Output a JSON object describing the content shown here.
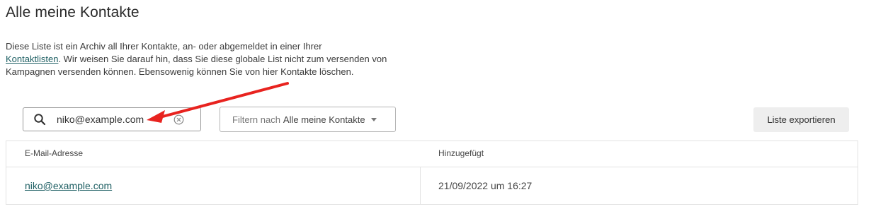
{
  "header": {
    "title": "Alle meine Kontakte"
  },
  "description": {
    "line1": "Diese Liste ist ein Archiv all Ihrer Kontakte, an- oder abgemeldet in einer Ihrer",
    "link": "Kontaktlisten",
    "rest": ". Wir weisen Sie darauf hin, dass Sie diese globale List nicht zum versenden von Kampagnen versenden können. Ebensowenig können Sie von hier Kontakte löschen."
  },
  "search": {
    "value": "niko@example.com",
    "icon": "search-icon",
    "clear_icon": "clear-icon"
  },
  "filter": {
    "prefix": "Filtern nach",
    "value": "Alle meine Kontakte"
  },
  "toolbar": {
    "export_label": "Liste exportieren"
  },
  "table": {
    "columns": [
      "E-Mail-Adresse",
      "Hinzugefügt"
    ],
    "rows": [
      {
        "email": "niko@example.com",
        "added": "21/09/2022 um 16:27"
      }
    ]
  },
  "annotation": {
    "arrow_color": "#e8231f"
  },
  "colors": {
    "link": "#1e5f63",
    "export_bg": "#eeeeee"
  }
}
